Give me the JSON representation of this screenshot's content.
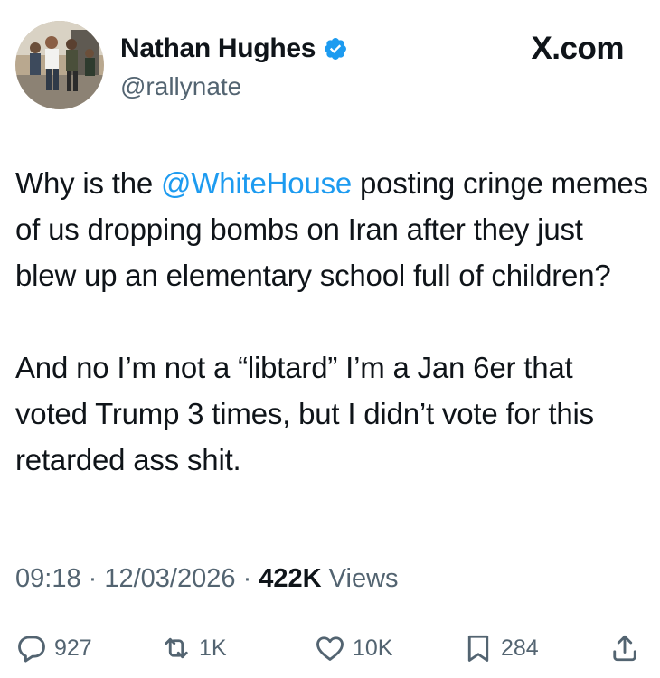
{
  "author": {
    "display_name": "Nathan Hughes",
    "handle": "@rallynate",
    "verified": true,
    "verified_color": "#1d9bf0",
    "avatar": "profile photo of people walking"
  },
  "site": {
    "label": "X.com"
  },
  "tweet": {
    "p1_before": "Why is the ",
    "mention": "@WhiteHouse",
    "p1_after": " posting cringe memes of us dropping bombs on Iran after they just blew up an elementary school full of children?",
    "p2": "And no I’m not a “libtard” I’m a Jan 6er that voted Trump 3 times, but I didn’t vote for this retarded ass shit.",
    "mention_color": "#1d9bf0"
  },
  "meta": {
    "time": "09:18",
    "sep1": " · ",
    "date": "12/03/2026",
    "sep2": " · ",
    "views_count": "422K",
    "views_label": " Views"
  },
  "actions": {
    "replies": "927",
    "reposts": "1K",
    "likes": "10K",
    "bookmarks": "284"
  },
  "icons": [
    "reply-icon",
    "repost-icon",
    "like-icon",
    "bookmark-icon",
    "share-icon",
    "verified-badge-icon"
  ]
}
